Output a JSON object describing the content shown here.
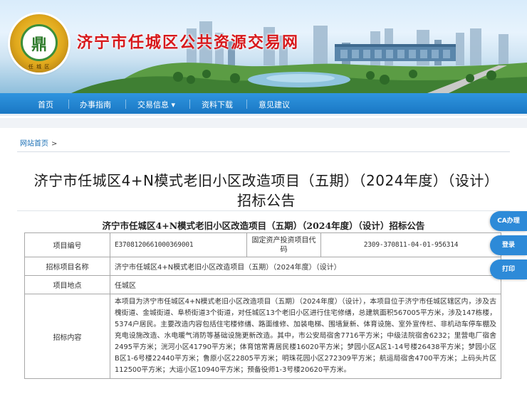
{
  "header": {
    "site_title": "济宁市任城区公共资源交易网",
    "logo_glyph": "鼎",
    "logo_ring_text": "任 城 区"
  },
  "nav": {
    "items": [
      "首页",
      "办事指南",
      "交易信息 ▾",
      "资料下载",
      "意见建议"
    ]
  },
  "breadcrumb": {
    "home": "网站首页",
    "separator": ">"
  },
  "page_title": "济宁市任城区4+N模式老旧小区改造项目（五期）（2024年度）（设计）招标公告",
  "notice_heading": "济宁市任城区4+N模式老旧小区改造项目（五期）（2024年度）（设计）招标公告",
  "table": {
    "row1": {
      "label1": "项目编号",
      "value1": "E3708120661000369001",
      "label2": "固定资产投资项目代码",
      "value2": "2309-370811-04-01-956314"
    },
    "row2": {
      "label": "招标项目名称",
      "value": "济宁市任城区4+N模式老旧小区改造项目（五期）（2024年度）（设计）"
    },
    "row3": {
      "label": "项目地点",
      "value": "任城区"
    },
    "row4": {
      "label": "招标内容",
      "value": "本项目为济宁市任城区4+N模式老旧小区改造项目（五期）（2024年度）（设计），本项目位于济宁市任城区辖区内，涉及古槐街道、金城街道、阜桥街道3个街道，对任城区13个老旧小区进行住宅修缮，总建筑面积567005平方米，涉及147栋楼，5374户居民。主要改造内容包括住宅楼修缮、路面维修、加装电梯、围墙复新、体育设施、室外宣传栏、非机动车停车棚及充电设施改造、水电暖气消防等基础设施更新改造。其中，市公安局宿舍7716平方米；中级法院宿舍6232；里营电厂宿舍2495平方米；洸河小区41790平方米；体育馆常青居民楼16020平方米；梦园小区A区1-14号楼26438平方米；梦园小区B区1-6号楼22440平方米；鲁原小区22805平方米；明珠花园小区272309平方米；航运局宿舍4700平方米；上码头片区112500平方米；大运小区10940平方米；预备役师1-3号楼20620平方米。"
    }
  },
  "side_buttons": {
    "ca": "CA办理",
    "login": "登录",
    "print": "打印"
  },
  "colors": {
    "brand_red": "#d7191c",
    "nav_blue": "#1a78c4",
    "link_blue": "#1a6fb5",
    "side_button_blue": "#2d8ad8"
  }
}
